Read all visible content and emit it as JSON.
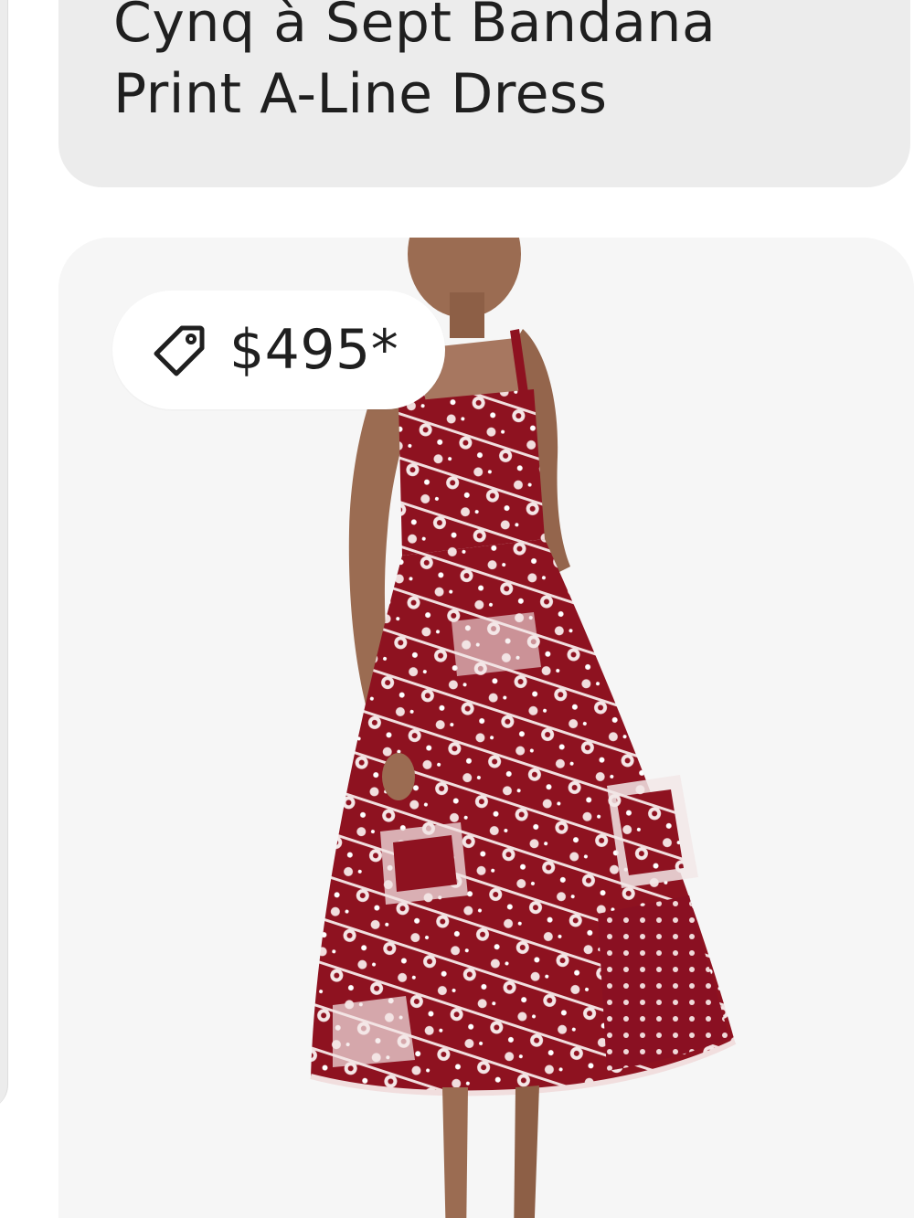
{
  "product": {
    "title": "Cynq à Sept Bandana Print A-Line Dress",
    "price": "$495*",
    "price_icon": "price-tag-icon",
    "image_subject": "model-wearing-red-bandana-print-midi-dress"
  },
  "colors": {
    "card_background": "#ececec",
    "image_background": "#f6f6f6",
    "dress_primary": "#8e1220",
    "dress_print": "#f1dede",
    "text": "#1f1f1f"
  }
}
